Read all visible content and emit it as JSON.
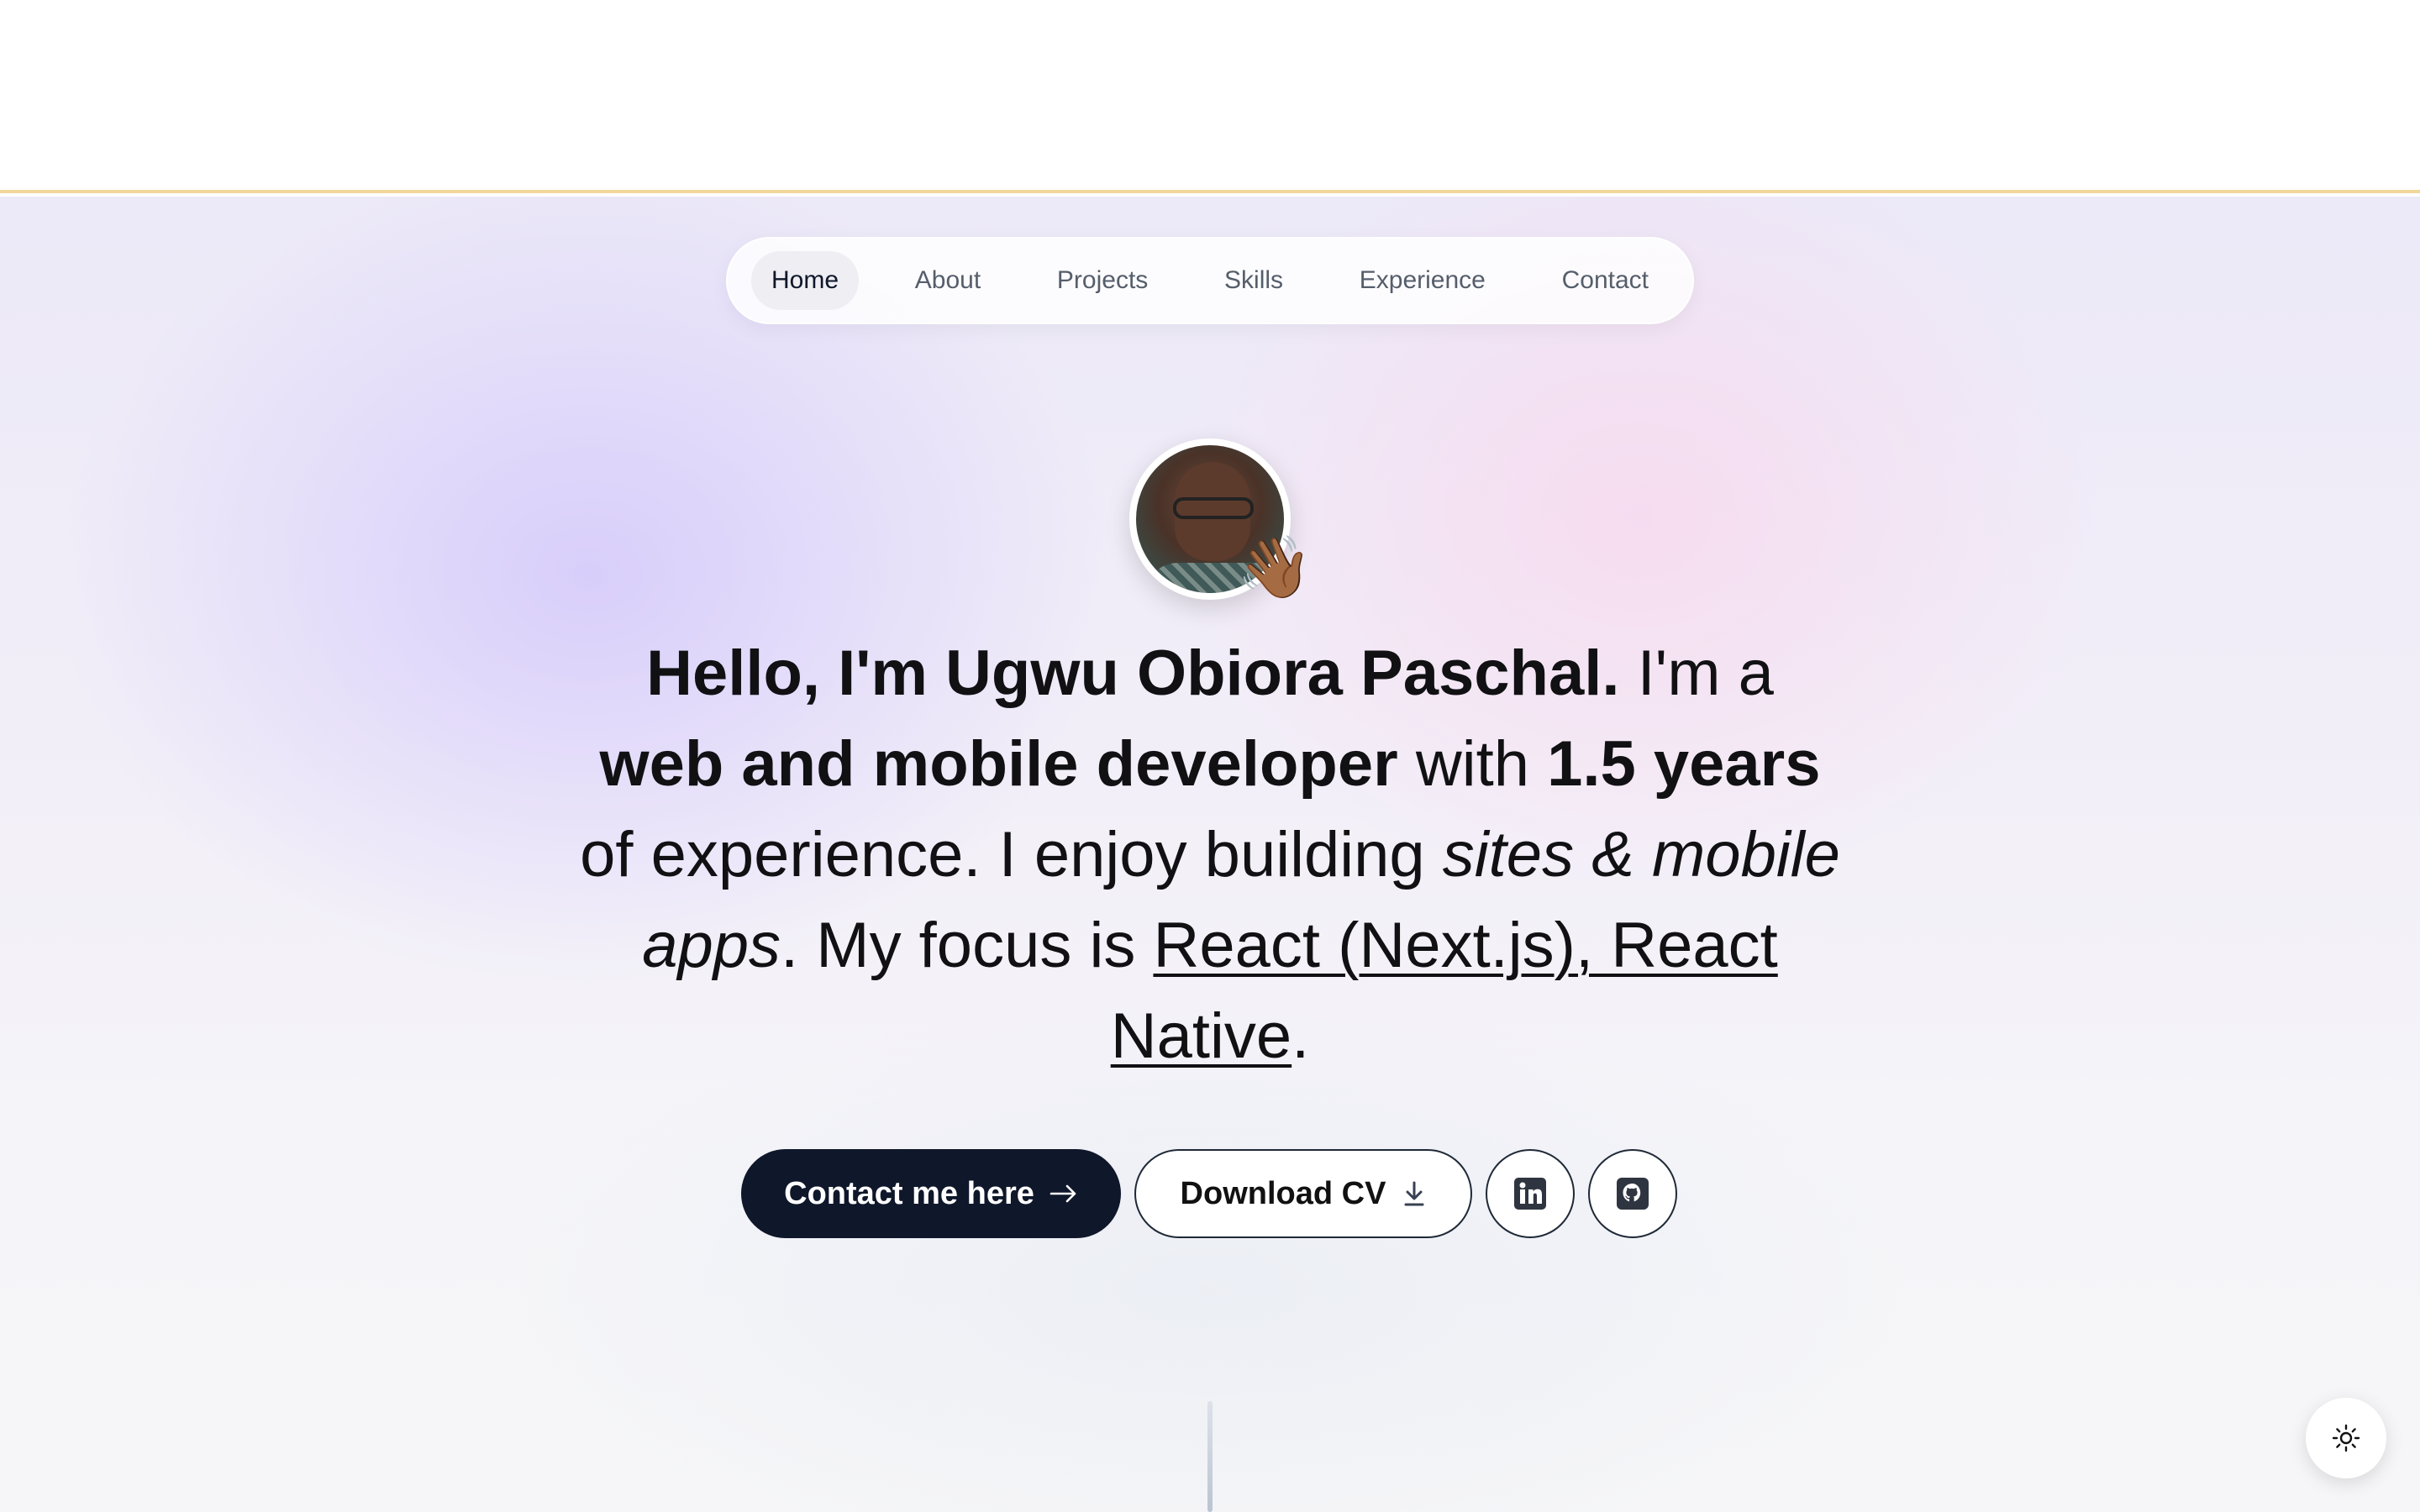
{
  "nav": {
    "items": [
      {
        "label": "Home",
        "active": true
      },
      {
        "label": "About"
      },
      {
        "label": "Projects"
      },
      {
        "label": "Skills"
      },
      {
        "label": "Experience"
      },
      {
        "label": "Contact"
      }
    ]
  },
  "avatar": {
    "emoji": "👋🏾"
  },
  "hero": {
    "greeting": "Hello, I'm Ugwu Obiora Paschal.",
    "im_a": " I'm a ",
    "role": "web and mobile developer",
    "with": " with ",
    "years": "1.5 years",
    "of_experience": " of experience. I enjoy building ",
    "building_what": "sites & mobile apps",
    "focus_intro": ". My focus is ",
    "focus": "React (Next.js), React Native",
    "end": "."
  },
  "actions": {
    "contact_label": "Contact me here",
    "cv_label": "Download CV",
    "linkedin_icon": "linkedin-icon",
    "github_icon": "github-icon"
  },
  "colors": {
    "primary": "#0f172a",
    "accent_border": "#f1d79a"
  },
  "theme_toggle_icon": "sun-icon"
}
